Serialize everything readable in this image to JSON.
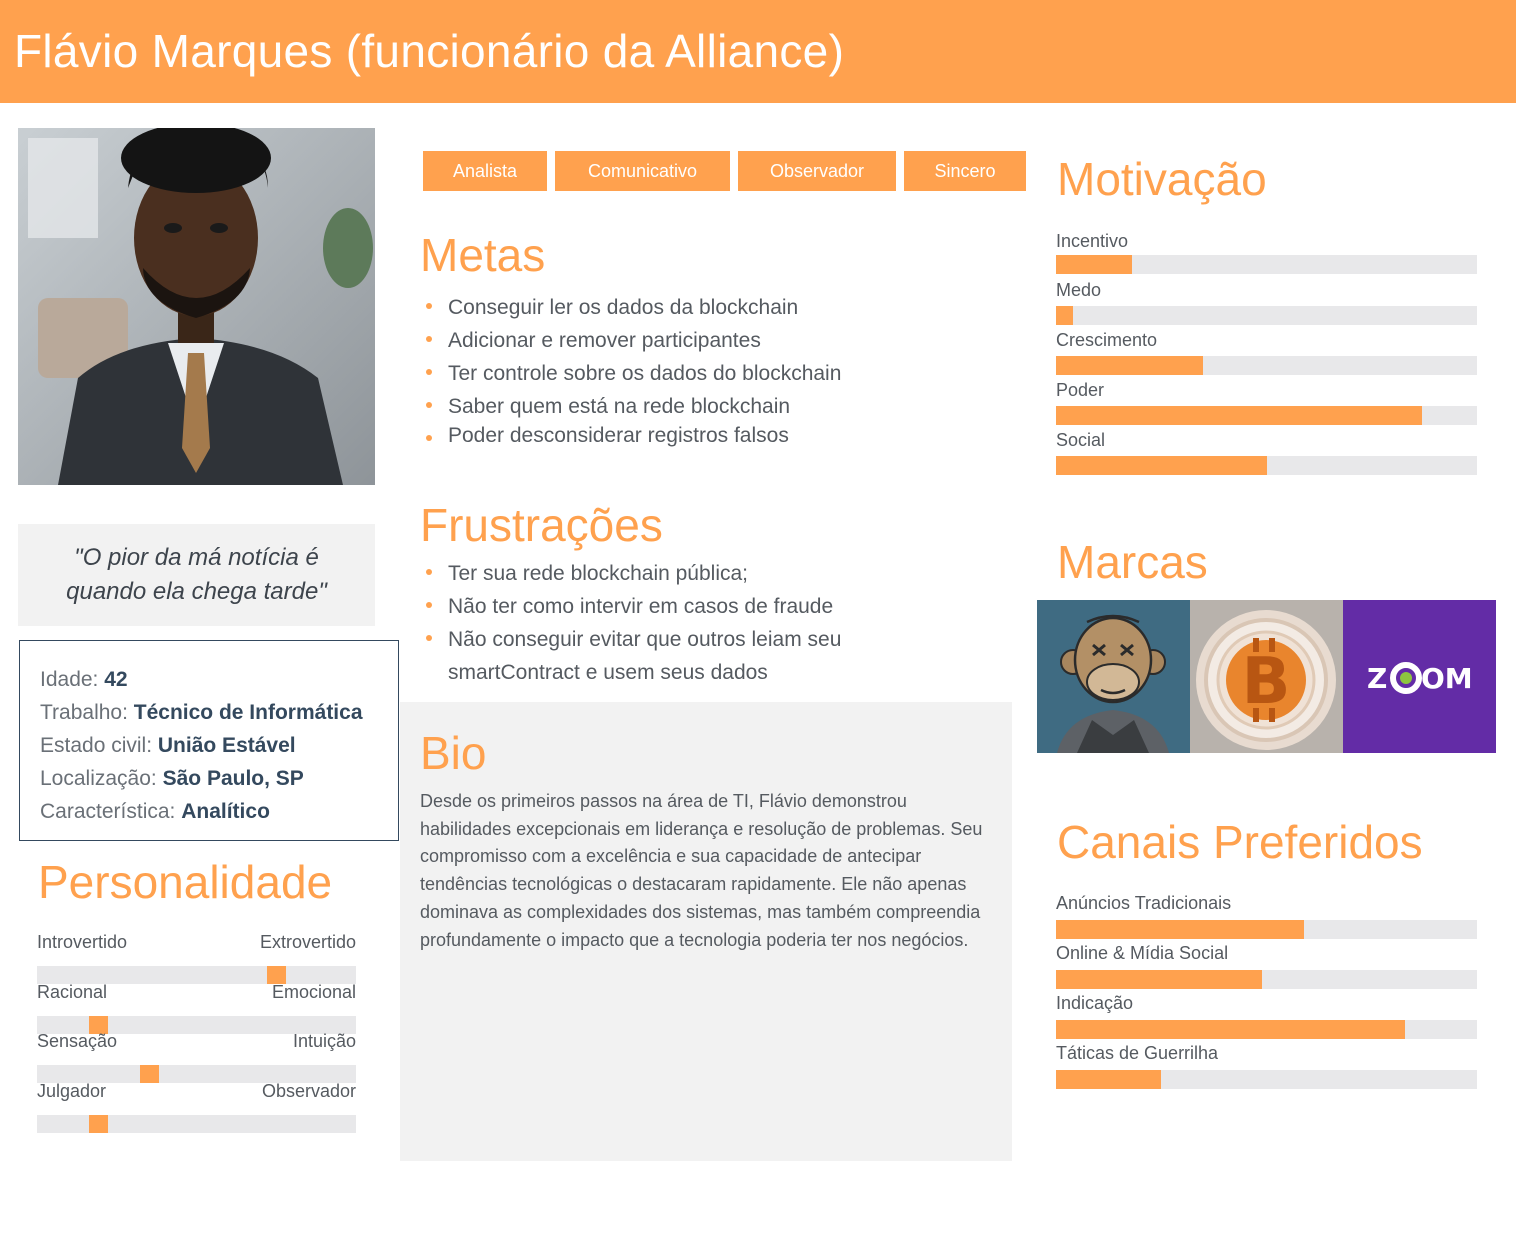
{
  "header": {
    "title": "Flávio Marques (funcionário da Alliance)"
  },
  "quote": "\"O pior da má notícia é quando ela chega tarde\"",
  "info": {
    "age_label": "Idade:",
    "age": "42",
    "job_label": "Trabalho:",
    "job": "Técnico de Informática",
    "civil_label": "Estado civil:",
    "civil": "União Estável",
    "location_label": "Localização:",
    "location": "São Paulo, SP",
    "trait_label": "Característica:",
    "trait": "Analítico"
  },
  "personality": {
    "title": "Personalidade",
    "scales": [
      {
        "left": "Introvertido",
        "right": "Extrovertido",
        "value": 0.75
      },
      {
        "left": "Racional",
        "right": "Emocional",
        "value": 0.19
      },
      {
        "left": "Sensação",
        "right": "Intuição",
        "value": 0.35
      },
      {
        "left": "Julgador",
        "right": "Observador",
        "value": 0.19
      }
    ]
  },
  "tags": [
    "Analista",
    "Comunicativo",
    "Observador",
    "Sincero"
  ],
  "goals": {
    "title": "Metas",
    "items": [
      "Conseguir ler os dados da blockchain",
      "Adicionar e remover participantes",
      "Ter controle sobre os dados do blockchain",
      "Saber quem está na rede blockchain",
      "Poder desconsiderar registros falsos"
    ]
  },
  "frustrations": {
    "title": "Frustrações",
    "items": [
      "Ter sua rede blockchain pública;",
      "Não ter como intervir em casos de fraude",
      "Não conseguir evitar que outros leiam seu smartContract e usem seus dados"
    ]
  },
  "bio": {
    "title": "Bio",
    "text": "Desde os primeiros passos na área de TI, Flávio demonstrou habilidades excepcionais em liderança e resolução de problemas. Seu compromisso com a excelência e sua capacidade de antecipar tendências tecnológicas o destacaram rapidamente. Ele não apenas dominava as complexidades dos sistemas, mas também compreendia profundamente o impacto que a tecnologia poderia ter nos negócios."
  },
  "motivation": {
    "title": "Motivação",
    "items": [
      {
        "label": "Incentivo",
        "value": 0.18
      },
      {
        "label": "Medo",
        "value": 0.04
      },
      {
        "label": "Crescimento",
        "value": 0.35
      },
      {
        "label": "Poder",
        "value": 0.87
      },
      {
        "label": "Social",
        "value": 0.5
      }
    ]
  },
  "brands": {
    "title": "Marcas",
    "logos": [
      "bored-ape-nft",
      "bitcoin",
      "zoom"
    ],
    "zoom_text": "ZOOM"
  },
  "channels": {
    "title": "Canais Preferidos",
    "items": [
      {
        "label": "Anúncios Tradicionais",
        "value": 0.59
      },
      {
        "label": "Online & Mídia Social",
        "value": 0.49
      },
      {
        "label": "Indicação",
        "value": 0.83
      },
      {
        "label": "Táticas de Guerrilha",
        "value": 0.25
      }
    ]
  },
  "colors": {
    "accent": "#ffa14e",
    "dark": "#34495e",
    "panel": "#f2f2f2",
    "track": "#e8e8ea"
  }
}
